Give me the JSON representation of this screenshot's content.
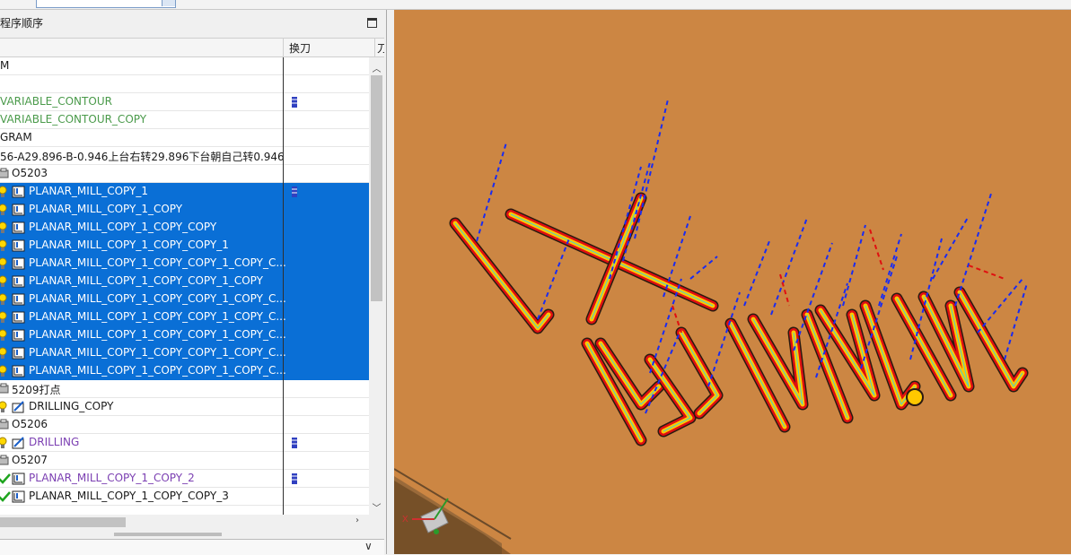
{
  "panel": {
    "title": "程序顺序",
    "columns": [
      "换刀",
      "刀"
    ]
  },
  "rows": [
    {
      "name": "M",
      "style": "normal",
      "icon": "none",
      "selected": false,
      "tool": false
    },
    {
      "name": "",
      "style": "normal",
      "icon": "none",
      "selected": false,
      "tool": false
    },
    {
      "name": "VARIABLE_CONTOUR",
      "style": "green",
      "icon": "none",
      "selected": false,
      "tool": true
    },
    {
      "name": "VARIABLE_CONTOUR_COPY",
      "style": "green",
      "icon": "none",
      "selected": false,
      "tool": false
    },
    {
      "name": "GRAM",
      "style": "normal",
      "icon": "none",
      "selected": false,
      "tool": false
    },
    {
      "name": "56-A29.896-B-0.946上台右转29.896下台朝自己转0.946",
      "style": "normal",
      "icon": "none",
      "selected": false,
      "tool": false
    },
    {
      "name": "O5203",
      "style": "normal",
      "icon": "folder",
      "selected": false,
      "tool": false
    },
    {
      "name": "PLANAR_MILL_COPY_1",
      "style": "normal",
      "icon": "planar",
      "selected": true,
      "tool": true
    },
    {
      "name": "PLANAR_MILL_COPY_1_COPY",
      "style": "normal",
      "icon": "planar",
      "selected": true,
      "tool": false
    },
    {
      "name": "PLANAR_MILL_COPY_1_COPY_COPY",
      "style": "normal",
      "icon": "planar",
      "selected": true,
      "tool": false
    },
    {
      "name": "PLANAR_MILL_COPY_1_COPY_COPY_1",
      "style": "normal",
      "icon": "planar",
      "selected": true,
      "tool": false
    },
    {
      "name": "PLANAR_MILL_COPY_1_COPY_COPY_1_COPY_C...",
      "style": "normal",
      "icon": "planar",
      "selected": true,
      "tool": false
    },
    {
      "name": "PLANAR_MILL_COPY_1_COPY_COPY_1_COPY",
      "style": "normal",
      "icon": "planar",
      "selected": true,
      "tool": false
    },
    {
      "name": "PLANAR_MILL_COPY_1_COPY_COPY_1_COPY_C...",
      "style": "normal",
      "icon": "planar",
      "selected": true,
      "tool": false
    },
    {
      "name": "PLANAR_MILL_COPY_1_COPY_COPY_1_COPY_C...",
      "style": "normal",
      "icon": "planar",
      "selected": true,
      "tool": false
    },
    {
      "name": "PLANAR_MILL_COPY_1_COPY_COPY_1_COPY_C...",
      "style": "normal",
      "icon": "planar",
      "selected": true,
      "tool": false
    },
    {
      "name": "PLANAR_MILL_COPY_1_COPY_COPY_1_COPY_C...",
      "style": "normal",
      "icon": "planar",
      "selected": true,
      "tool": false
    },
    {
      "name": "PLANAR_MILL_COPY_1_COPY_COPY_1_COPY_C...",
      "style": "normal",
      "icon": "planar",
      "selected": true,
      "tool": false
    },
    {
      "name": "5209打点",
      "style": "normal",
      "icon": "folder",
      "selected": false,
      "tool": false
    },
    {
      "name": "DRILLING_COPY",
      "style": "normal",
      "icon": "drill",
      "selected": false,
      "tool": false
    },
    {
      "name": "O5206",
      "style": "normal",
      "icon": "folder",
      "selected": false,
      "tool": false
    },
    {
      "name": "DRILLING",
      "style": "purple",
      "icon": "drill",
      "selected": false,
      "tool": true
    },
    {
      "name": "O5207",
      "style": "normal",
      "icon": "folder",
      "selected": false,
      "tool": false
    },
    {
      "name": "PLANAR_MILL_COPY_1_COPY_2",
      "style": "purple",
      "icon": "planar-check",
      "selected": false,
      "tool": true
    },
    {
      "name": "PLANAR_MILL_COPY_1_COPY_COPY_3",
      "style": "normal",
      "icon": "planar-check",
      "selected": false,
      "tool": false
    }
  ],
  "view": {
    "axis_x": "X",
    "icons": [
      "triad-icon",
      "cube-icon"
    ]
  },
  "colors": {
    "selection": "#0a6fd6",
    "viewport": "#cc8643",
    "toolpath_blue": "#1a2cf0",
    "toolpath_red": "#e01010",
    "toolpath_yellow": "#ffc800"
  }
}
